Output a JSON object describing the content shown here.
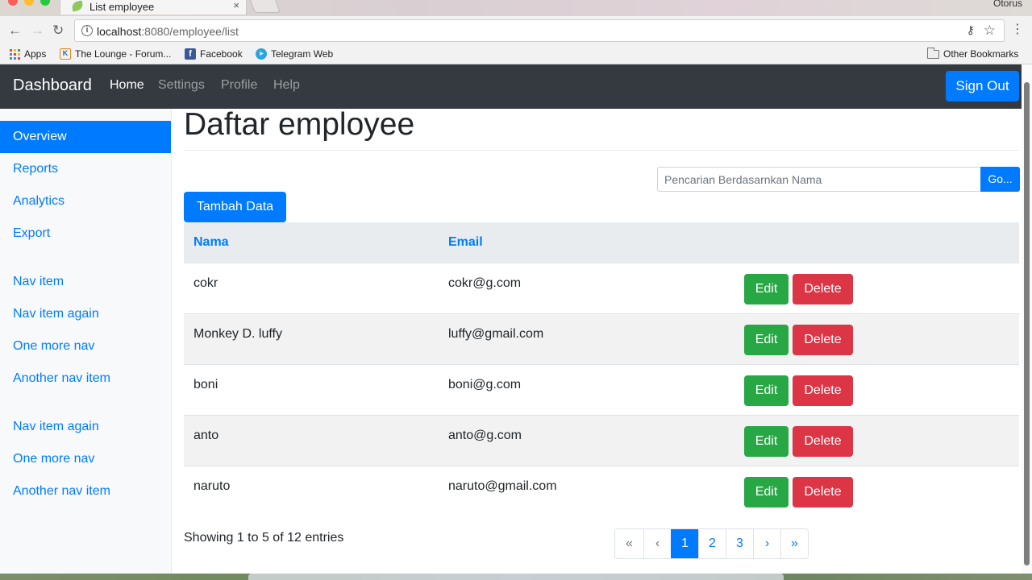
{
  "browser": {
    "tab_title": "List employee",
    "tab_close": "×",
    "profile_name": "Otorus",
    "back": "←",
    "forward": "→",
    "reload": "↻",
    "url_host": "localhost",
    "url_rest": ":8080/employee/list",
    "info_glyph": "i",
    "key_glyph": "⚷",
    "star_glyph": "☆",
    "menu_glyph": "⋮",
    "bookmarks": [
      {
        "label": "Apps",
        "icon": "apps-grid-icon"
      },
      {
        "label": "The Lounge - Forum...",
        "icon": "lounge-icon"
      },
      {
        "label": "Facebook",
        "icon": "facebook-icon"
      },
      {
        "label": "Telegram Web",
        "icon": "telegram-icon"
      }
    ],
    "other_bookmarks": "Other Bookmarks"
  },
  "navbar": {
    "brand": "Dashboard",
    "links": [
      "Home",
      "Settings",
      "Profile",
      "Help"
    ],
    "active_link": "Home",
    "signout_label": "Sign Out"
  },
  "sidebar": {
    "items": [
      "Overview",
      "Reports",
      "Analytics",
      "Export",
      "Nav item",
      "Nav item again",
      "One more nav",
      "Another nav item",
      "Nav item again",
      "One more nav",
      "Another nav item"
    ],
    "active": "Overview"
  },
  "main": {
    "title": "Daftar employee",
    "search_placeholder": "Pencarian Berdasarnkan Nama",
    "search_button": "Go...",
    "add_button": "Tambah Data",
    "columns": [
      "Nama",
      "Email"
    ],
    "rows": [
      {
        "nama": "cokr",
        "email": "cokr@g.com"
      },
      {
        "nama": "Monkey D. luffy",
        "email": "luffy@gmail.com"
      },
      {
        "nama": "boni",
        "email": "boni@g.com"
      },
      {
        "nama": "anto",
        "email": "anto@g.com"
      },
      {
        "nama": "naruto",
        "email": "naruto@gmail.com"
      }
    ],
    "edit_label": "Edit",
    "delete_label": "Delete",
    "showing_text": "Showing 1 to 5 of 12 entries",
    "pagination": [
      "«",
      "‹",
      "1",
      "2",
      "3",
      "›",
      "»"
    ],
    "current_page": "1"
  },
  "colors": {
    "primary": "#007bff",
    "success": "#28a745",
    "danger": "#dc3545",
    "navbar_bg": "#343a40",
    "sidebar_bg": "#f8f9fa"
  }
}
